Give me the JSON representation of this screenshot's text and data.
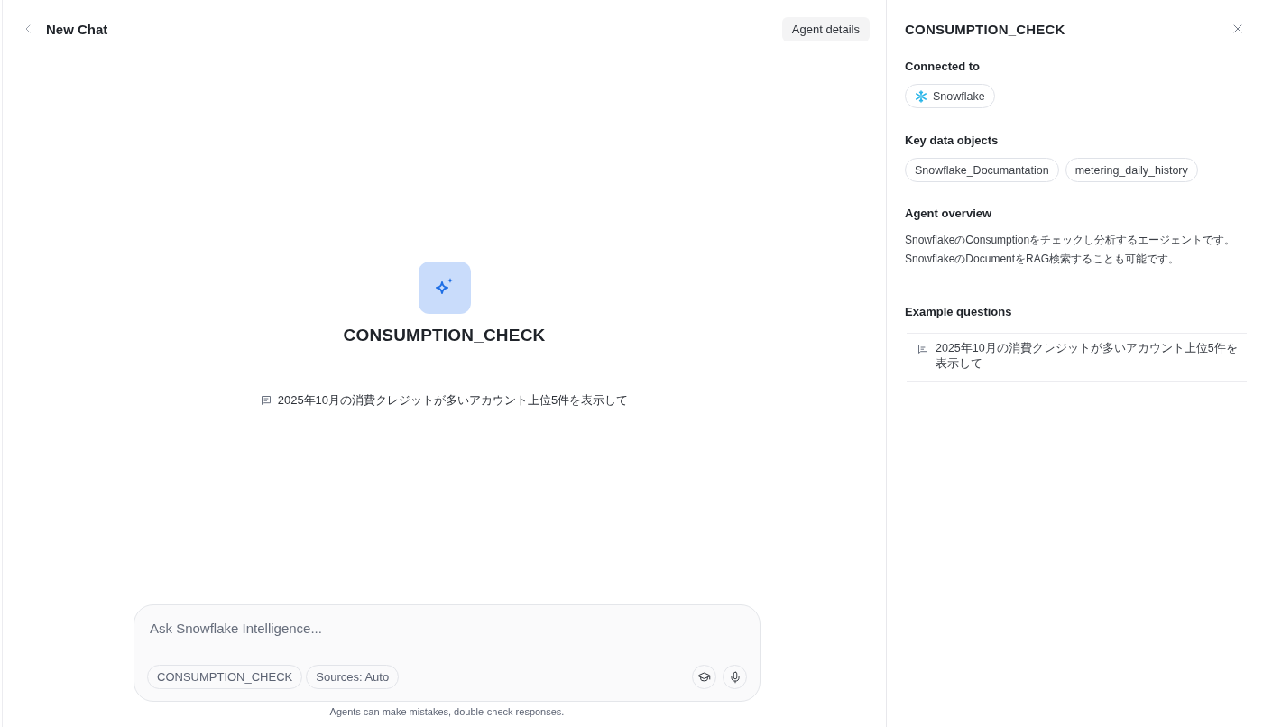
{
  "header": {
    "title": "New Chat",
    "details_button": "Agent details"
  },
  "agent": {
    "name": "CONSUMPTION_CHECK",
    "suggestions": [
      "2025年10月の消費クレジットが多いアカウント上位5件を表示して"
    ]
  },
  "composer": {
    "placeholder": "Ask Snowflake Intelligence...",
    "chips": [
      "CONSUMPTION_CHECK",
      "Sources: Auto"
    ],
    "disclaimer": "Agents can make mistakes, double-check responses."
  },
  "details_panel": {
    "title": "CONSUMPTION_CHECK",
    "sections": [
      {
        "kind": "connections",
        "heading": "Connected to",
        "items": [
          "Snowflake"
        ]
      },
      {
        "kind": "objects",
        "heading": "Key data objects",
        "items": [
          "Snowflake_Documantation",
          "metering_daily_history"
        ]
      },
      {
        "kind": "overview",
        "heading": "Agent overview",
        "items": [
          "SnowflakeのConsumptionをチェックし分析するエージェントです。",
          "SnowflakeのDocumentをRAG検索することも可能です。"
        ]
      },
      {
        "kind": "questions",
        "heading": "Example questions",
        "items": [
          "2025年10月の消費クレジットが多いアカウント上位5件を表示して"
        ]
      }
    ]
  }
}
